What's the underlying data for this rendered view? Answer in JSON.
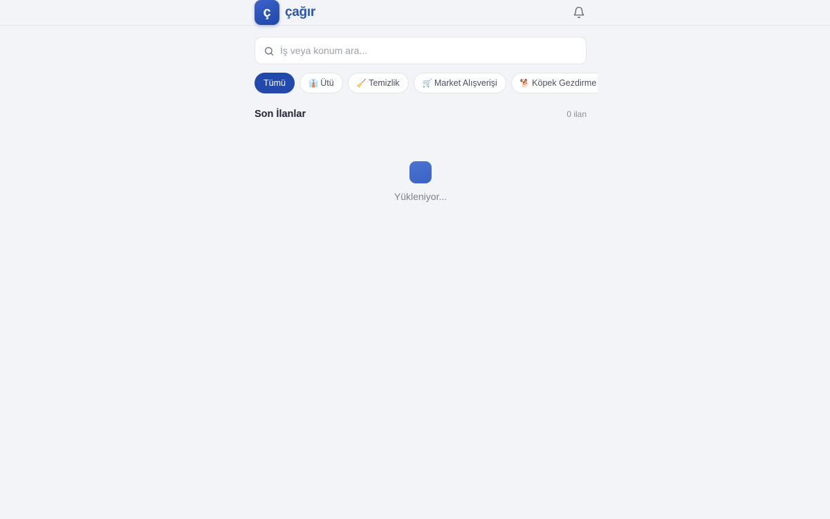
{
  "header": {
    "logo_letter": "ç",
    "brand": "çağır",
    "notifications_icon": "bell-icon"
  },
  "search": {
    "placeholder": "İş veya konum ara...",
    "value": "",
    "icon": "search-icon"
  },
  "categories": [
    {
      "emoji": "",
      "label": "Tümü",
      "active": true
    },
    {
      "emoji": "👔",
      "label": "Ütü",
      "active": false
    },
    {
      "emoji": "🧹",
      "label": "Temizlik",
      "active": false
    },
    {
      "emoji": "🛒",
      "label": "Market Alışverişi",
      "active": false
    },
    {
      "emoji": "🐕",
      "label": "Köpek Gezdirme",
      "active": false
    }
  ],
  "listings": {
    "title": "Son İlanlar",
    "count": "0 ilan",
    "loading_text": "Yükleniyor..."
  },
  "colors": {
    "accent": "#2349ad",
    "brand_text": "#2a55b8",
    "background": "#f3f4f8"
  }
}
